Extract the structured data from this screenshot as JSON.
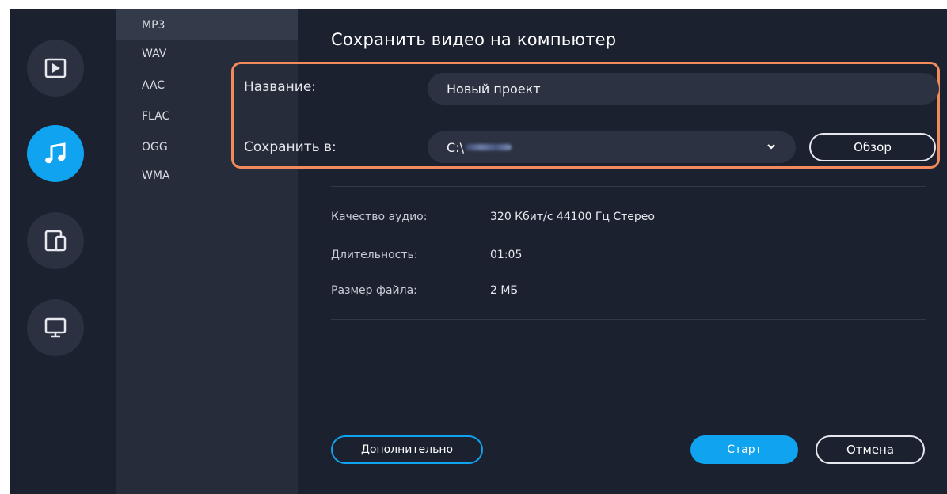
{
  "rail": {
    "items": [
      {
        "name": "video",
        "icon": "play-icon"
      },
      {
        "name": "audio",
        "icon": "music-note-icon",
        "active": true
      },
      {
        "name": "devices",
        "icon": "devices-icon"
      },
      {
        "name": "tv",
        "icon": "monitor-icon"
      }
    ]
  },
  "formats": {
    "items": [
      "MP3",
      "WAV",
      "AAC",
      "FLAC",
      "OGG",
      "WMA"
    ],
    "selected": "MP3"
  },
  "dialog": {
    "title": "Сохранить видео на компьютер",
    "name_label": "Название:",
    "name_value": "Новый проект",
    "save_to_label": "Сохранить в:",
    "save_to_value": "C:\\",
    "browse_label": "Обзор",
    "info": {
      "quality_label": "Качество аудио:",
      "quality_value": "320 Кбит/с 44100 Гц Стерео",
      "duration_label": "Длительность:",
      "duration_value": "01:05",
      "size_label": "Размер файла:",
      "size_value": "2 МБ"
    },
    "advanced_label": "Дополнительно",
    "start_label": "Старт",
    "cancel_label": "Отмена"
  },
  "colors": {
    "accent": "#0fa3f0",
    "highlight": "#f28a5e",
    "background": "#1c2130",
    "panel": "#262c3a"
  }
}
